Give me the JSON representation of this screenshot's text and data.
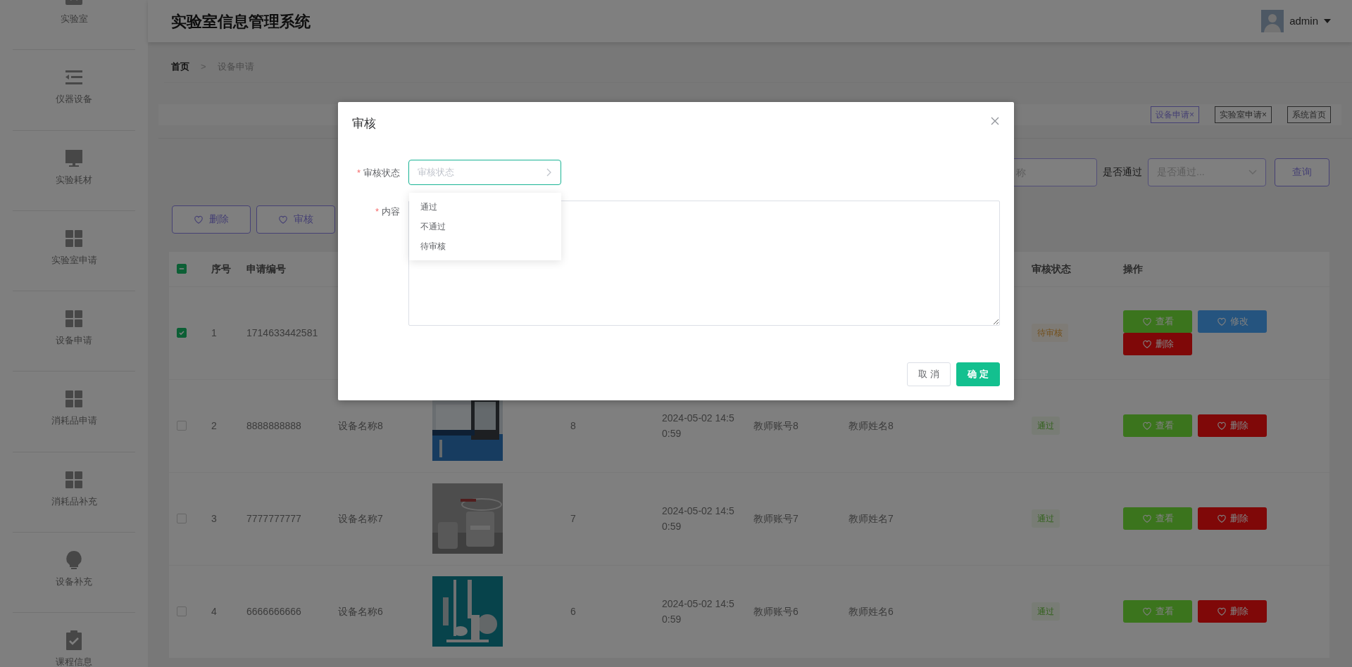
{
  "sidebar": {
    "items": [
      {
        "label": "实验室",
        "kind": "box"
      },
      {
        "label": "仪器设备",
        "kind": "list"
      },
      {
        "label": "实验耗材",
        "kind": "monitor"
      },
      {
        "label": "实验室申请",
        "kind": "grid"
      },
      {
        "label": "设备申请",
        "kind": "grid"
      },
      {
        "label": "消耗品申请",
        "kind": "grid"
      },
      {
        "label": "消耗品补充",
        "kind": "grid"
      },
      {
        "label": "设备补充",
        "kind": "bulb"
      },
      {
        "label": "课程信息",
        "kind": "clipboard"
      }
    ]
  },
  "header": {
    "title": "实验室信息管理系统",
    "user": "admin"
  },
  "breadcrumb": {
    "items": [
      "首页",
      "设备申请"
    ],
    "separator": ">"
  },
  "tags": [
    {
      "label": "设备申请×",
      "selected": true
    },
    {
      "label": "实验室申请×",
      "selected": false
    },
    {
      "label": "系统首页",
      "selected": false
    }
  ],
  "search": {
    "name_placeholder": "称",
    "pass_label": "是否通过",
    "pass_placeholder": "是否通过...",
    "button": "查询"
  },
  "toolbar": [
    "删除",
    "审核"
  ],
  "table": {
    "select_all": {
      "indeterminate": true
    },
    "columns_left": [
      "序号",
      "申请编号"
    ],
    "columns_right": [
      "审核状态",
      "操作"
    ],
    "rows": [
      {
        "checked": true,
        "index": "1",
        "code": "1714633442581",
        "status": {
          "text": "待审核",
          "kind": "pending"
        },
        "actions": [
          {
            "label": "查看",
            "kind": "view"
          },
          {
            "label": "修改",
            "kind": "edit"
          },
          {
            "label": "删除",
            "kind": "delete"
          }
        ]
      },
      {
        "checked": false,
        "index": "2",
        "code": "8888888888",
        "name": "设备名称8",
        "image": {
          "kind": "picture"
        },
        "quantity": "8",
        "date": "2024-05-02 14:50:59",
        "teacher_account": "教师账号8",
        "teacher_name": "教师姓名8",
        "status": {
          "text": "通过",
          "kind": "passed"
        },
        "actions": [
          {
            "label": "查看",
            "kind": "view"
          },
          {
            "label": "删除",
            "kind": "delete"
          }
        ]
      },
      {
        "checked": false,
        "index": "3",
        "code": "7777777777",
        "name": "设备名称7",
        "image": {
          "kind": "picture"
        },
        "quantity": "7",
        "date": "2024-05-02 14:50:59",
        "teacher_account": "教师账号7",
        "teacher_name": "教师姓名7",
        "status": {
          "text": "通过",
          "kind": "passed"
        },
        "actions": [
          {
            "label": "查看",
            "kind": "view"
          },
          {
            "label": "删除",
            "kind": "delete"
          }
        ]
      },
      {
        "checked": false,
        "index": "4",
        "code": "6666666666",
        "name": "设备名称6",
        "image": {
          "kind": "picture"
        },
        "quantity": "6",
        "date": "2024-05-02 14:50:59",
        "teacher_account": "教师账号6",
        "teacher_name": "教师姓名6",
        "status": {
          "text": "通过",
          "kind": "passed"
        },
        "actions": [
          {
            "label": "查看",
            "kind": "view"
          },
          {
            "label": "删除",
            "kind": "delete"
          }
        ]
      }
    ]
  },
  "dialog": {
    "title": "审核",
    "fields": [
      {
        "kind": "select",
        "mark": "*",
        "label": "审核状态",
        "placeholder": "审核状态",
        "open": true,
        "options": [
          "通过",
          "不通过",
          "待审核"
        ]
      },
      {
        "kind": "textarea",
        "mark": "*",
        "label": "内容"
      }
    ],
    "buttons": [
      {
        "label": "取 消",
        "kind": "default"
      },
      {
        "label": "确 定",
        "kind": "primary"
      }
    ]
  }
}
